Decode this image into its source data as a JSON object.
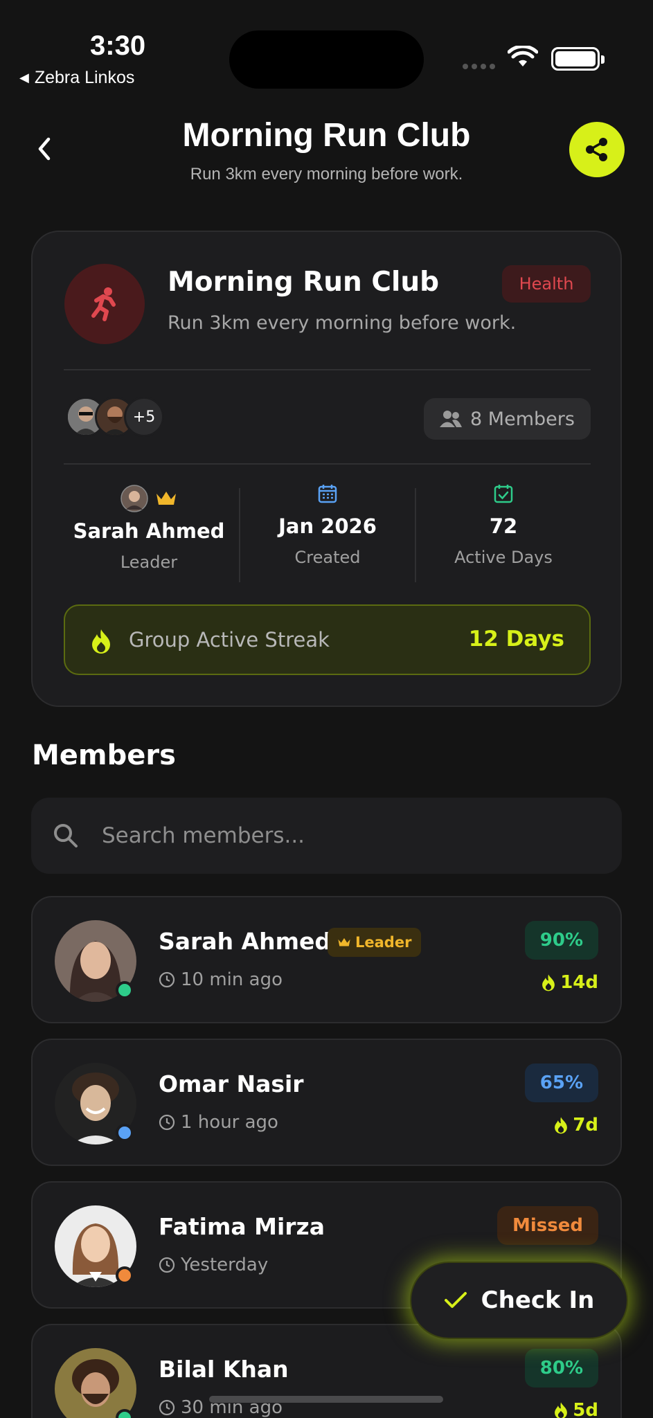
{
  "status_bar": {
    "time": "3:30",
    "back_app": "Zebra Linkos"
  },
  "header": {
    "title": "Morning Run Club",
    "subtitle": "Run 3km every morning before work."
  },
  "group_card": {
    "title": "Morning Run Club",
    "description": "Run 3km every morning before work.",
    "category": "Health",
    "avatars_more": "+5",
    "members_count": "8 Members",
    "leader": {
      "name": "Sarah Ahmed",
      "label": "Leader"
    },
    "created": {
      "value": "Jan 2026",
      "label": "Created"
    },
    "active_days": {
      "value": "72",
      "label": "Active Days"
    },
    "streak": {
      "label": "Group Active Streak",
      "value": "12 Days"
    }
  },
  "members_section": {
    "title": "Members",
    "search_placeholder": "Search members...",
    "items": [
      {
        "name": "Sarah Ahmed",
        "leader_tag": "Leader",
        "seen": "10 min ago",
        "badge": "90%",
        "streak": "14d",
        "status": "online"
      },
      {
        "name": "Omar Nasir",
        "seen": "1 hour ago",
        "badge": "65%",
        "streak": "7d",
        "status": "away"
      },
      {
        "name": "Fatima Mirza",
        "seen": "Yesterday",
        "badge": "Missed",
        "streak": "",
        "status": "idle"
      },
      {
        "name": "Bilal Khan",
        "seen": "30 min ago",
        "badge": "80%",
        "streak": "5d",
        "status": "online"
      }
    ]
  },
  "check_in_button": "Check In",
  "colors": {
    "accent": "#d7f019",
    "background": "#141414",
    "card": "#1d1d1f",
    "health": "#e0484f",
    "leader_gold": "#f0b62b",
    "green": "#2ecc8a",
    "blue": "#5aa2f5",
    "orange": "#f08a3c"
  }
}
